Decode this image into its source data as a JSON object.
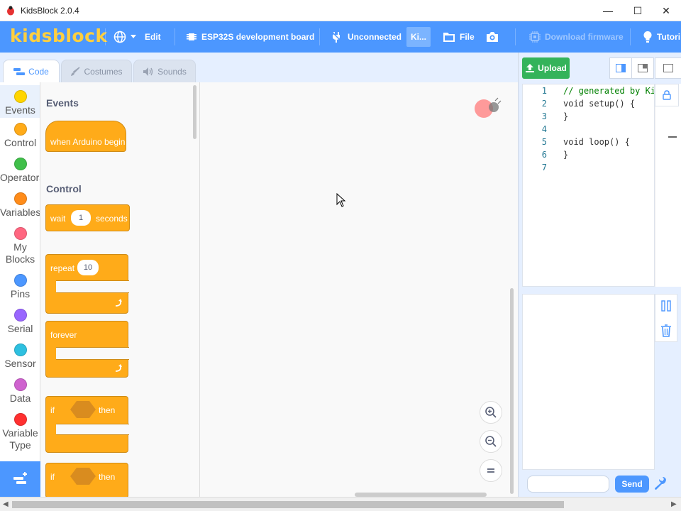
{
  "window": {
    "title": "KidsBlock 2.0.4",
    "minimize_glyph": "—",
    "maximize_glyph": "☐",
    "close_glyph": "✕"
  },
  "menubar": {
    "logo": "kidsblock",
    "language_icon": "globe-icon",
    "edit": "Edit",
    "board": "ESP32S development board",
    "connection": "Unconnected",
    "mode": "Ki...",
    "file": "File",
    "screenshot_icon": "camera-icon",
    "download_firmware": "Download firmware",
    "tutorial": "Tutori"
  },
  "tabs": {
    "code": "Code",
    "costumes": "Costumes",
    "sounds": "Sounds"
  },
  "categories": [
    {
      "label": "Events",
      "color": "#ffd500"
    },
    {
      "label": "Control",
      "color": "#ffab19"
    },
    {
      "label": "Operators",
      "color": "#40bf4a"
    },
    {
      "label": "Variables",
      "color": "#ff8c1a"
    },
    {
      "label": "My Blocks",
      "color": "#ff6680"
    },
    {
      "label": "Pins",
      "color": "#4c97ff"
    },
    {
      "label": "Serial",
      "color": "#9966ff"
    },
    {
      "label": "Sensor",
      "color": "#2ec0e0"
    },
    {
      "label": "Data",
      "color": "#cf63cf"
    },
    {
      "label": "Variable Type",
      "color": "#ff3030"
    }
  ],
  "flyout": {
    "events_heading": "Events",
    "when_begin": "when Arduino begin",
    "control_heading": "Control",
    "wait_label": "wait",
    "wait_value": "1",
    "wait_suffix": "seconds",
    "repeat_label": "repeat",
    "repeat_value": "10",
    "forever_label": "forever",
    "if_label": "if",
    "then_label": "then",
    "if2_label": "if",
    "then2_label": "then"
  },
  "right_panel": {
    "upload": "Upload",
    "send": "Send",
    "code_lines": [
      {
        "n": "1",
        "text": "// generated by KidsBlock"
      },
      {
        "n": "2",
        "text": "void setup() {"
      },
      {
        "n": "3",
        "text": "}"
      },
      {
        "n": "4",
        "text": ""
      },
      {
        "n": "5",
        "text": "void loop() {"
      },
      {
        "n": "6",
        "text": "}"
      },
      {
        "n": "7",
        "text": ""
      }
    ]
  },
  "colors": {
    "brand_blue": "#4c97ff",
    "logo_yellow": "#ffcf3f",
    "control_orange": "#ffab19",
    "upload_green": "#34b35a"
  }
}
